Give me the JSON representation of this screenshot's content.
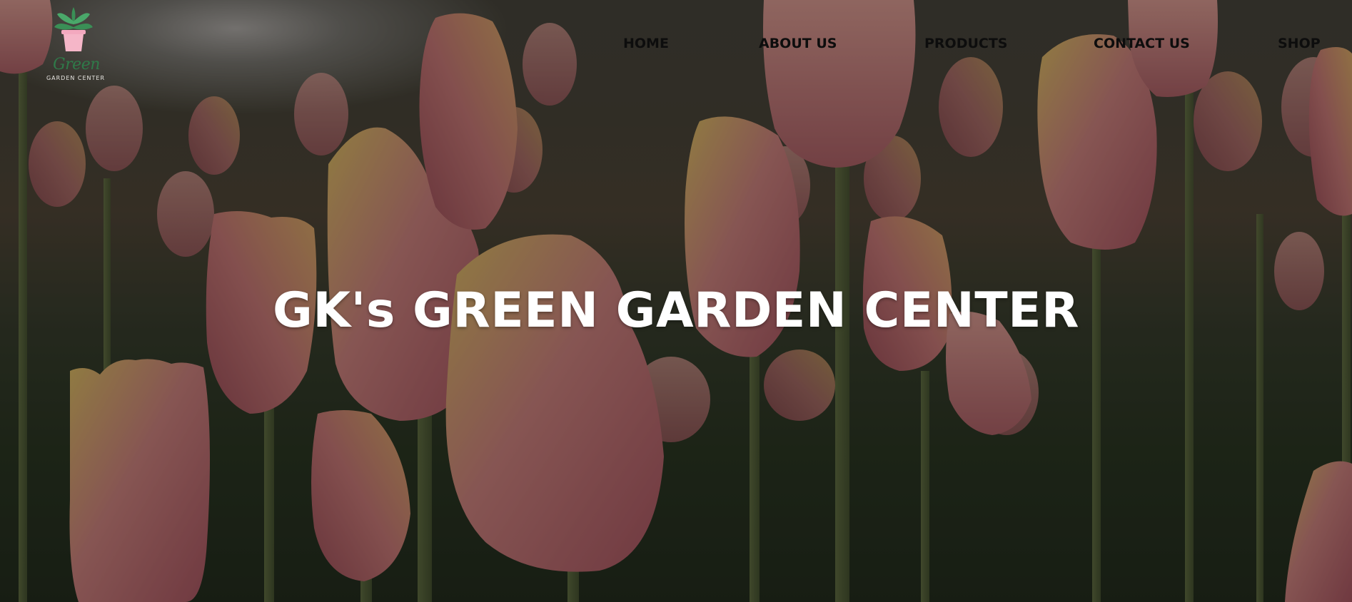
{
  "logo": {
    "word": "Green",
    "subtitle": "GARDEN CENTER",
    "icon": "potted-plant-icon"
  },
  "nav": {
    "items": [
      {
        "label": "HOME"
      },
      {
        "label": "ABOUT US"
      },
      {
        "label": "PRODUCTS"
      },
      {
        "label": "CONTACT US"
      },
      {
        "label": "SHOP"
      }
    ]
  },
  "hero": {
    "title": "GK's GREEN GARDEN CENTER",
    "background": "tulip-field-photo"
  },
  "colors": {
    "nav_text": "#0d0d0d",
    "title_text": "#ffffff",
    "logo_green": "#2f7a49",
    "logo_pot": "#f5b6c8"
  }
}
